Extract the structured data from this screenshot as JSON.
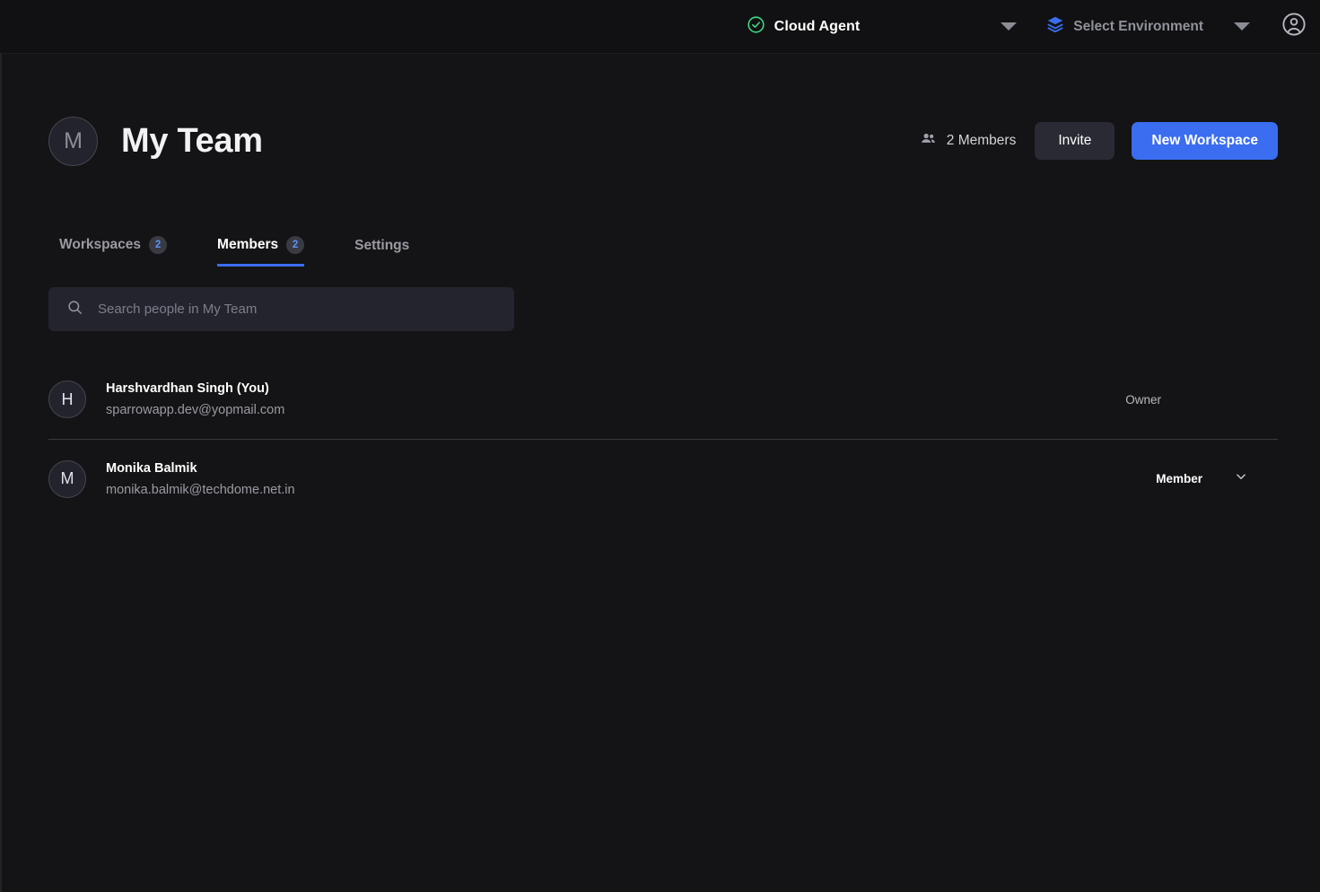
{
  "topbar": {
    "status_icon": "check-circle-icon",
    "agent_label": "Cloud Agent",
    "agent_caret": "caret-down-icon",
    "env_icon": "layers-icon",
    "env_label": "Select Environment",
    "env_caret": "caret-down-icon",
    "account_icon": "account-circle-icon",
    "status_color": "#3ddc84",
    "env_icon_color": "#3a6df0"
  },
  "header": {
    "avatar_initial": "M",
    "title": "My Team",
    "members_icon": "people-icon",
    "members_count_label": "2 Members",
    "invite_label": "Invite",
    "new_workspace_label": "New Workspace",
    "accent_color": "#3a6df0"
  },
  "tabs": [
    {
      "label": "Workspaces",
      "badge": "2",
      "active": false
    },
    {
      "label": "Members",
      "badge": "2",
      "active": true
    },
    {
      "label": "Settings",
      "badge": "",
      "active": false
    }
  ],
  "search": {
    "icon": "search-icon",
    "value": "",
    "placeholder": "Search people in My Team"
  },
  "members": [
    {
      "avatar_initial": "H",
      "name": "Harshvardhan Singh (You)",
      "email": "sparrowapp.dev@yopmail.com",
      "role": "Owner",
      "has_dropdown": false
    },
    {
      "avatar_initial": "M",
      "name": "Monika Balmik",
      "email": "monika.balmik@techdome.net.in",
      "role": "Member",
      "has_dropdown": true
    }
  ]
}
